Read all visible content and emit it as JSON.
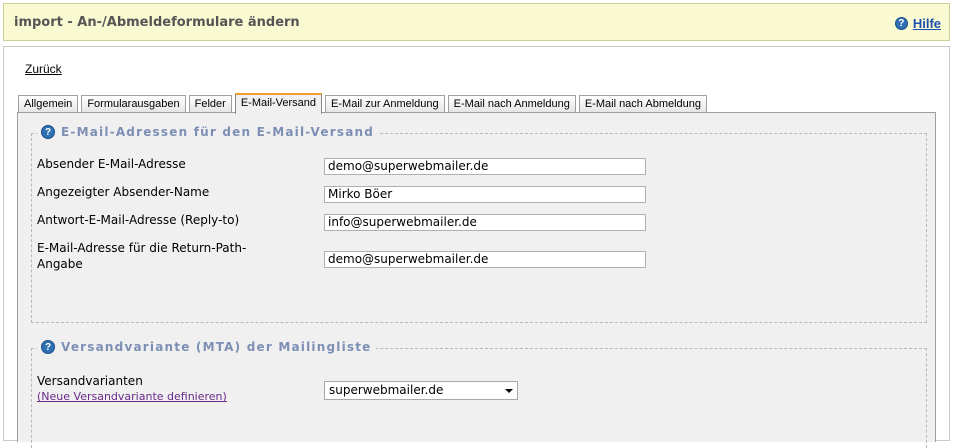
{
  "header": {
    "title": "import - An-/Abmeldeformulare ändern",
    "help_icon": "?",
    "help_label": "Hilfe"
  },
  "nav": {
    "back_label": "Zurück"
  },
  "tabs": [
    {
      "label": "Allgemein"
    },
    {
      "label": "Formularausgaben"
    },
    {
      "label": "Felder"
    },
    {
      "label": "E-Mail-Versand",
      "active": true
    },
    {
      "label": "E-Mail zur Anmeldung"
    },
    {
      "label": "E-Mail nach Anmeldung"
    },
    {
      "label": "E-Mail nach Abmeldung"
    }
  ],
  "section_addresses": {
    "icon": "?",
    "legend": "E-Mail-Adressen für den E-Mail-Versand",
    "fields": [
      {
        "label": "Absender E-Mail-Adresse",
        "value": "demo@superwebmailer.de"
      },
      {
        "label": "Angezeigter Absender-Name",
        "value": "Mirko Böer"
      },
      {
        "label": "Antwort-E-Mail-Adresse (Reply-to)",
        "value": "info@superwebmailer.de"
      },
      {
        "label_line1": "E-Mail-Adresse für die Return-Path-",
        "label_line2": "Angabe",
        "value": "demo@superwebmailer.de"
      }
    ]
  },
  "section_mta": {
    "icon": "?",
    "legend": "Versandvariante (MTA) der Mailingliste",
    "label": "Versandvarianten",
    "new_link": "(Neue Versandvariante definieren)",
    "selected": "superwebmailer.de"
  },
  "colors": {
    "title_bg": "#fafad2",
    "legend_text": "#7d8fb4",
    "help_link": "#1f4fae",
    "active_tab_accent": "#f0a030",
    "panel_bg": "#f0f0f0"
  }
}
